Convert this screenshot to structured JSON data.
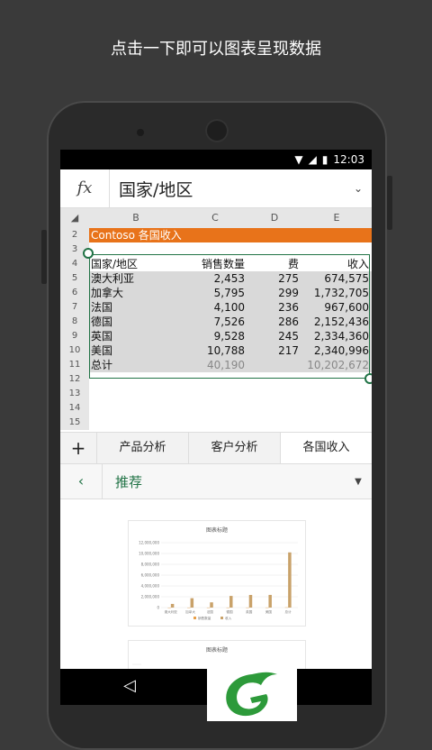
{
  "headline": "点击一下即可以图表呈现数据",
  "status": {
    "time": "12:03"
  },
  "formula": {
    "fx": "fx",
    "text": "国家/地区"
  },
  "columns": [
    "B",
    "C",
    "D",
    "E"
  ],
  "rows": [
    {
      "num": "2",
      "title": "Contoso 各国收入"
    },
    {
      "num": "3"
    },
    {
      "num": "4",
      "b": "国家/地区",
      "c": "销售数量",
      "d": "费",
      "e": "收入"
    },
    {
      "num": "5",
      "b": "澳大利亚",
      "c": "2,453",
      "d": "275",
      "e": "674,575"
    },
    {
      "num": "6",
      "b": "加拿大",
      "c": "5,795",
      "d": "299",
      "e": "1,732,705"
    },
    {
      "num": "7",
      "b": "法国",
      "c": "4,100",
      "d": "236",
      "e": "967,600"
    },
    {
      "num": "8",
      "b": "德国",
      "c": "7,526",
      "d": "286",
      "e": "2,152,436"
    },
    {
      "num": "9",
      "b": "英国",
      "c": "9,528",
      "d": "245",
      "e": "2,334,360"
    },
    {
      "num": "10",
      "b": "美国",
      "c": "10,788",
      "d": "217",
      "e": "2,340,996"
    },
    {
      "num": "11",
      "b": "总计",
      "c": "40,190",
      "d": "",
      "e": "10,202,672"
    },
    {
      "num": "12"
    },
    {
      "num": "13"
    },
    {
      "num": "14"
    },
    {
      "num": "15"
    }
  ],
  "tabs": {
    "add": "+",
    "items": [
      "产品分析",
      "客户分析",
      "各国收入"
    ]
  },
  "recommend": {
    "back": "‹",
    "title": "推荐"
  },
  "chart_data": [
    {
      "type": "bar",
      "title": "图表标题",
      "categories": [
        "澳大利亚",
        "加拿大",
        "法国",
        "德国",
        "英国",
        "美国",
        "总计"
      ],
      "series": [
        {
          "name": "销售数量",
          "values": [
            2453,
            5795,
            4100,
            7526,
            9528,
            10788,
            40190
          ]
        },
        {
          "name": "收入",
          "values": [
            674575,
            1732705,
            967600,
            2152436,
            2334360,
            2340996,
            10202672
          ]
        }
      ],
      "yticks": [
        "0",
        "2,000,000",
        "4,000,000",
        "6,000,000",
        "8,000,000",
        "10,000,000",
        "12,000,000"
      ],
      "ylim": [
        0,
        12000000
      ],
      "colors": [
        "#e8a04a",
        "#c9a26a"
      ]
    },
    {
      "type": "bar",
      "title": "图表标题"
    }
  ]
}
